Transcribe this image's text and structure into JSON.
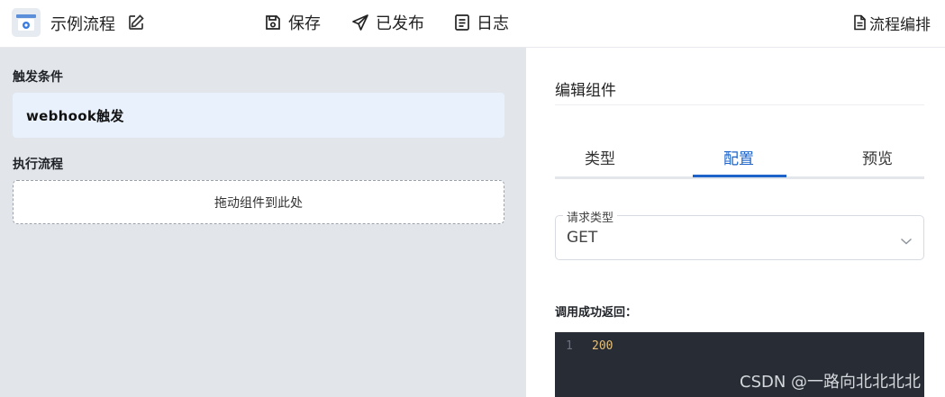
{
  "header": {
    "app_title": "示例流程",
    "save_label": "保存",
    "publish_label": "已发布",
    "log_label": "日志",
    "orchestrate_label": "流程编排"
  },
  "canvas": {
    "trigger_section_label": "触发条件",
    "trigger_card_label": "webhook触发",
    "flow_section_label": "执行流程",
    "dropzone_text": "拖动组件到此处"
  },
  "editor": {
    "title": "编辑组件",
    "tabs": [
      {
        "label": "类型",
        "active": false
      },
      {
        "label": "配置",
        "active": true
      },
      {
        "label": "预览",
        "active": false
      }
    ],
    "request_type_label": "请求类型",
    "request_type_value": "GET",
    "success_return_label": "调用成功返回：",
    "code": {
      "line_number": "1",
      "line_text": "200"
    }
  },
  "watermark": "CSDN @一路向北北北北",
  "colors": {
    "accent": "#1d63c9",
    "canvas_bg": "#e2e5ea",
    "trigger_card_bg": "#e9f1fc",
    "code_bg": "#282c34",
    "code_number": "#e5c07b"
  },
  "icons": {
    "logo": "flow-app-icon",
    "edit": "pencil-square-icon",
    "save": "floppy-disk-icon",
    "publish": "paper-plane-icon",
    "log": "document-lines-icon",
    "orchestrate": "document-icon",
    "select": "chevron-down-icon"
  }
}
